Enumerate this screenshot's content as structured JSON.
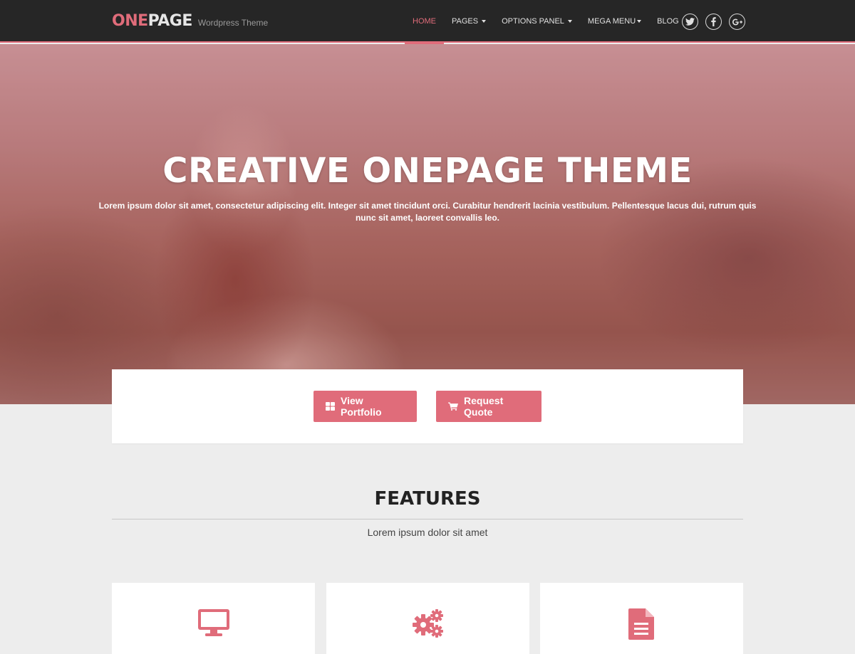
{
  "header": {
    "brand_primary": "ONE",
    "brand_secondary": "PAGE",
    "tagline": "Wordpress Theme",
    "nav": [
      {
        "label": "HOME",
        "active": true,
        "dropdown": false
      },
      {
        "label": "PAGES",
        "active": false,
        "dropdown": true
      },
      {
        "label": "OPTIONS PANEL",
        "active": false,
        "dropdown": true
      },
      {
        "label": "MEGA MENU",
        "active": false,
        "dropdown": true
      },
      {
        "label": "BLOG",
        "active": false,
        "dropdown": false
      }
    ],
    "social": [
      "twitter-icon",
      "facebook-icon",
      "google-plus-icon"
    ]
  },
  "hero": {
    "title": "CREATIVE ONEPAGE THEME",
    "text": "Lorem ipsum dolor sit amet, consectetur adipiscing elit. Integer sit amet tincidunt orci. Curabitur hendrerit lacinia vestibulum. Pellentesque lacus dui, rutrum quis nunc sit amet, laoreet convallis leo."
  },
  "cta": {
    "portfolio_label": "View Portfolio",
    "portfolio_icon": "grid-icon",
    "quote_label": "Request Quote",
    "quote_icon": "cart-icon"
  },
  "features": {
    "title": "FEATURES",
    "subtitle": "Lorem ipsum dolor sit amet",
    "cards": [
      {
        "icon": "monitor-icon"
      },
      {
        "icon": "gears-icon"
      },
      {
        "icon": "document-icon"
      }
    ]
  },
  "colors": {
    "accent": "#e06c7a",
    "header_bg": "#262626",
    "page_bg": "#ededed"
  }
}
